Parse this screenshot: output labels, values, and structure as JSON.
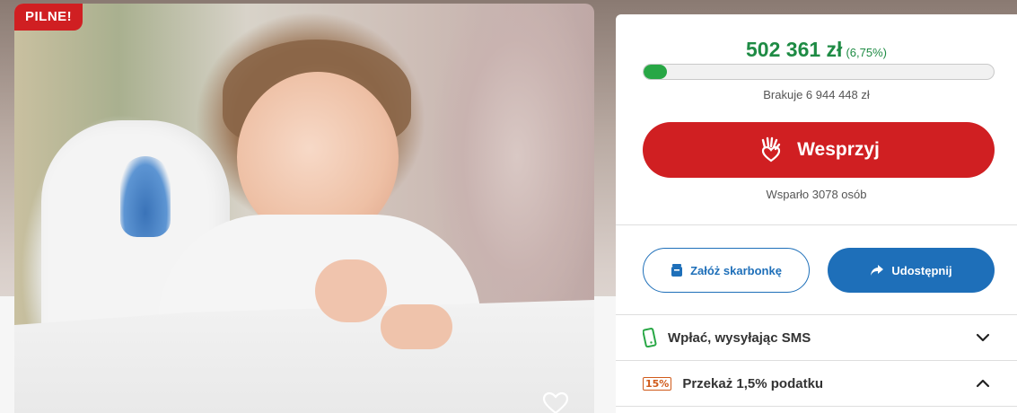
{
  "photo": {
    "badge": "PILNE!"
  },
  "panel": {
    "amount": "502 361 zł",
    "percent_label": "(6,75%)",
    "progress": 0.0675,
    "missing": "Brakuje 6 944 448 zł",
    "support_button": "Wesprzyj",
    "supported_count": "Wsparło 3078 osób",
    "piggybank_button": "Załóż skarbonkę",
    "share_button": "Udostępnij",
    "sms_row": "Wpłać, wysyłając SMS",
    "tax_row": "Przekaż 1,5% podatku",
    "tax_icon": "15%"
  },
  "colors": {
    "brand_red": "#d01f22",
    "success_green": "#1e8b44",
    "primary_blue": "#1e6fb9"
  }
}
